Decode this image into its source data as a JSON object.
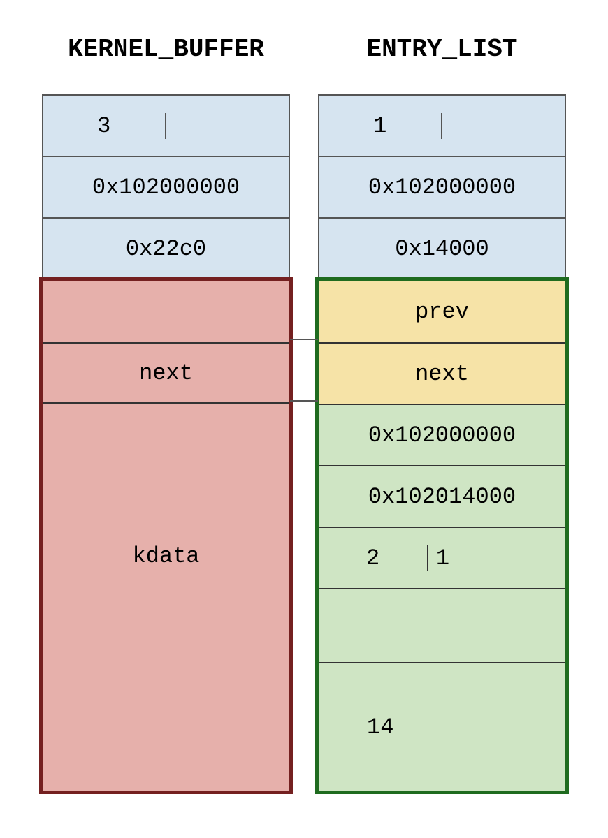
{
  "titles": {
    "left": "KERNEL_BUFFER",
    "right": "ENTRY_LIST"
  },
  "left": {
    "header_count": "3",
    "addr1": "0x102000000",
    "addr2": "0x22c0",
    "next": "next",
    "kdata": "kdata"
  },
  "right": {
    "header_count": "1",
    "addr1": "0x102000000",
    "addr2": "0x14000",
    "prev": "prev",
    "next": "next",
    "val1": "0x102000000",
    "val2": "0x102014000",
    "small_a": "2",
    "small_b": "1",
    "last": "14"
  }
}
